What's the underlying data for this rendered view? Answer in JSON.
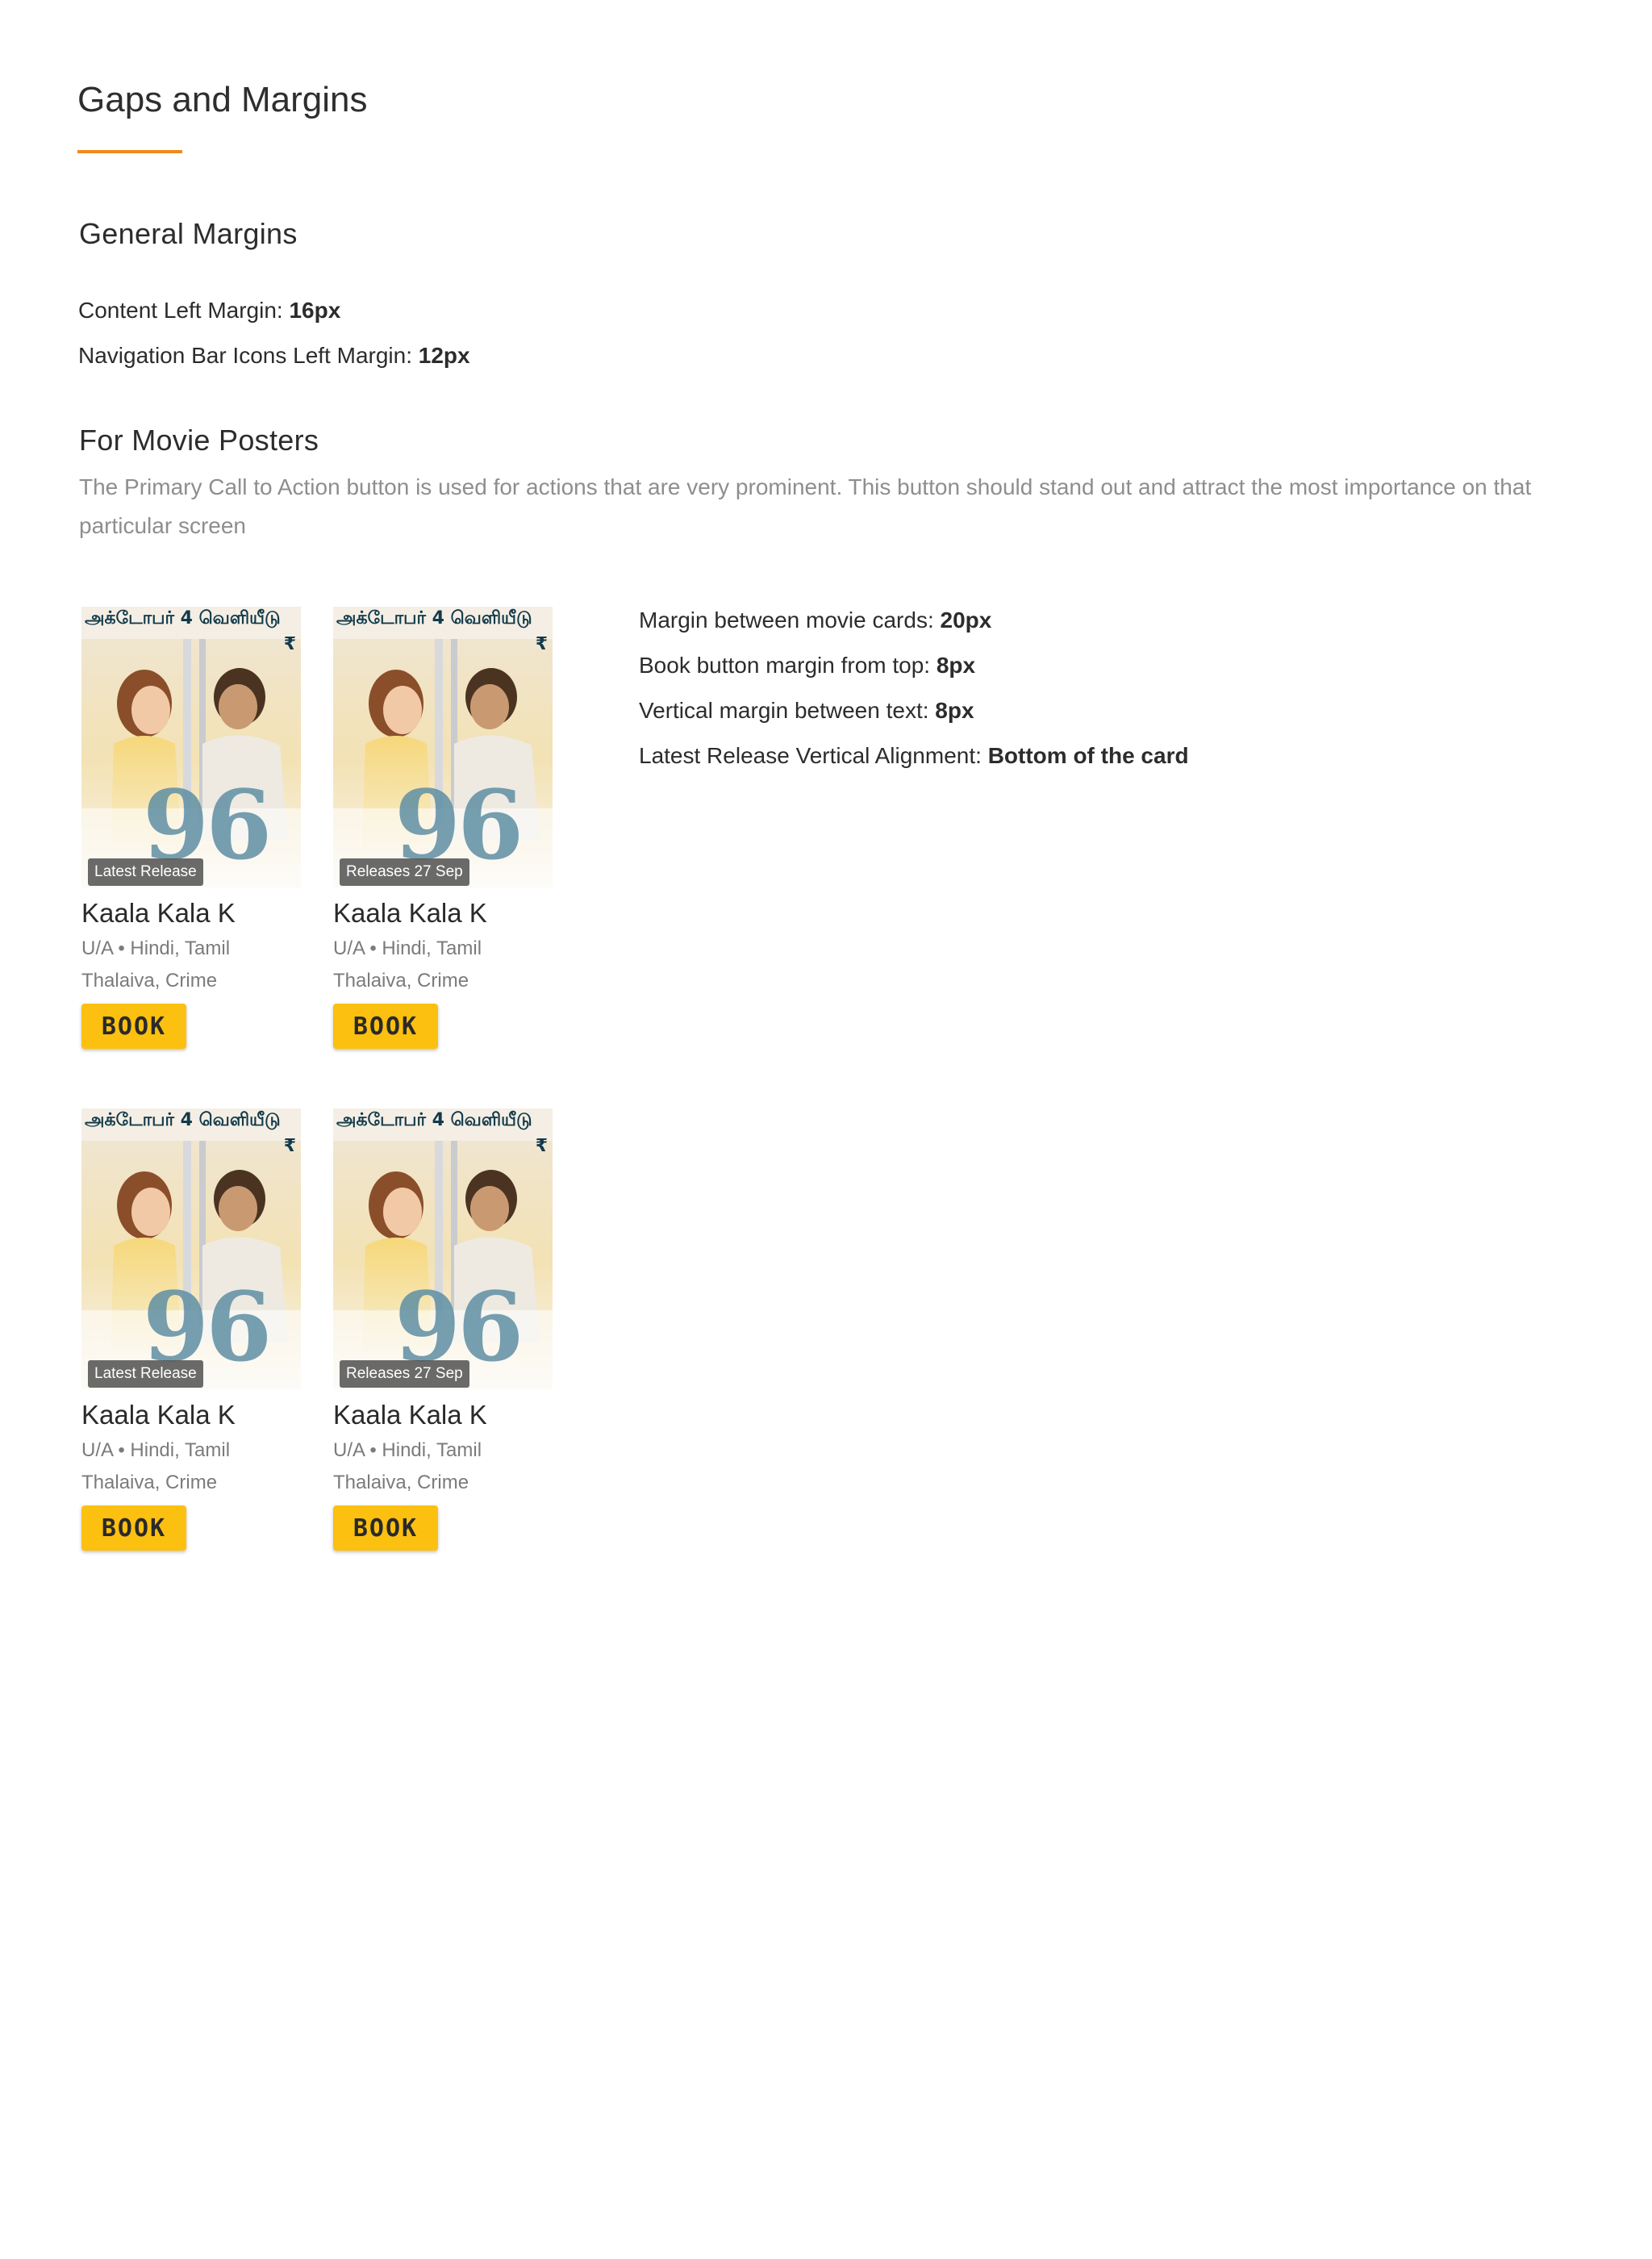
{
  "page": {
    "title": "Gaps and Margins",
    "accent_color": "#f0891c"
  },
  "general": {
    "heading": "General Margins",
    "specs": [
      {
        "label": "Content Left Margin: ",
        "value": "16px"
      },
      {
        "label": "Navigation Bar Icons Left Margin: ",
        "value": "12px"
      }
    ]
  },
  "posters": {
    "heading": "For Movie Posters",
    "description": "The Primary Call to Action button is used for actions that are very prominent. This button should stand out and attract the most importance on that particular screen",
    "specs": [
      {
        "label": "Margin between movie cards: ",
        "value": "20px"
      },
      {
        "label": "Book button margin from top: ",
        "value": "8px"
      },
      {
        "label": "Vertical margin between text: ",
        "value": "8px"
      },
      {
        "label": "Latest Release Vertical Alignment: ",
        "value": "Bottom of the card"
      }
    ]
  },
  "poster_art": {
    "top_text": "அக்டோபர் 4 வெளியீடு",
    "big_number": "96",
    "rupee": "₹"
  },
  "cards": [
    {
      "badge": "Latest Release",
      "title": "Kaala Kala K",
      "meta": "U/A • Hindi, Tamil",
      "genre": "Thalaiva, Crime",
      "button": "BOOK"
    },
    {
      "badge": "Releases 27 Sep",
      "title": "Kaala Kala K",
      "meta": "U/A • Hindi, Tamil",
      "genre": "Thalaiva, Crime",
      "button": "BOOK"
    },
    {
      "badge": "Latest Release",
      "title": "Kaala Kala K",
      "meta": "U/A • Hindi, Tamil",
      "genre": "Thalaiva, Crime",
      "button": "BOOK"
    },
    {
      "badge": "Releases 27 Sep",
      "title": "Kaala Kala K",
      "meta": "U/A • Hindi, Tamil",
      "genre": "Thalaiva, Crime",
      "button": "BOOK"
    }
  ],
  "colors": {
    "book_button": "#fcc010",
    "badge_bg": "#505050",
    "muted_text": "#8e8e8e"
  }
}
